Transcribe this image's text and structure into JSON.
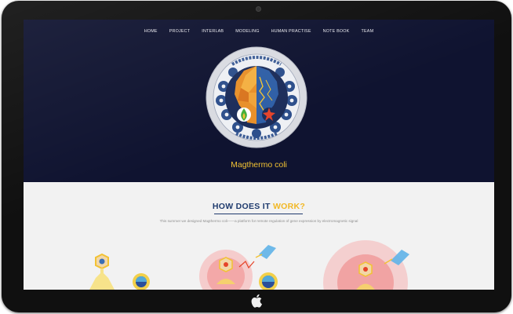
{
  "nav": {
    "items": [
      {
        "label": "HOME"
      },
      {
        "label": "PROJECT"
      },
      {
        "label": "INTERLAB"
      },
      {
        "label": "MODELING"
      },
      {
        "label": "HUMAN PRACTISE"
      },
      {
        "label": "NOTE BOOK"
      },
      {
        "label": "TEAM"
      }
    ]
  },
  "hero": {
    "title": "Magthermo coli",
    "emblem_text_top": "",
    "emblem_text_bottom": ""
  },
  "section": {
    "heading_part1": "HOW DOES IT ",
    "heading_part2": "WORK?",
    "description": "This summer we designed Magthermo coli——a platform for remote regulation of gene expression by electromagnetic signal"
  },
  "colors": {
    "hero_bg": "#0f1330",
    "accent_yellow": "#f2c233",
    "heading_blue": "#1f3b6e",
    "section_bg": "#f2f2f2",
    "monitor_bezel": "#101010"
  },
  "icons": {
    "monitor_logo": "apple-logo-icon",
    "emblem": "team-emblem-icon"
  }
}
